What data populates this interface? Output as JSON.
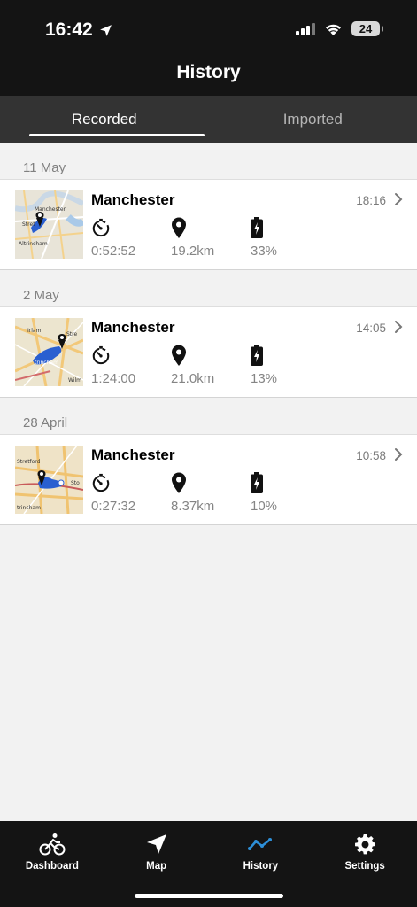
{
  "status_bar": {
    "time": "16:42",
    "battery_level": "24",
    "icons": [
      "location-arrow-icon",
      "signal-icon",
      "wifi-icon",
      "battery-icon"
    ]
  },
  "header": {
    "title": "History"
  },
  "tabs": [
    {
      "label": "Recorded",
      "active": true
    },
    {
      "label": "Imported",
      "active": false
    }
  ],
  "rides": [
    {
      "date": "11 May",
      "city": "Manchester",
      "time": "18:16",
      "duration": "0:52:52",
      "distance": "19.2km",
      "battery": "33%",
      "map_labels": [
        "Manchester",
        "Stret",
        "Altrincham"
      ]
    },
    {
      "date": "2 May",
      "city": "Manchester",
      "time": "14:05",
      "duration": "1:24:00",
      "distance": "21.0km",
      "battery": "13%",
      "map_labels": [
        "Irlam",
        "Stre",
        "trincham",
        "Wilm"
      ]
    },
    {
      "date": "28 April",
      "city": "Manchester",
      "time": "10:58",
      "duration": "0:27:32",
      "distance": "8.37km",
      "battery": "10%",
      "map_labels": [
        "Stretford",
        "Sto",
        "trincham"
      ]
    }
  ],
  "stat_icons": [
    "stopwatch-icon",
    "map-pin-icon",
    "battery-charging-icon"
  ],
  "bottom_nav": [
    {
      "label": "Dashboard",
      "icon": "bicycle-icon",
      "active": false
    },
    {
      "label": "Map",
      "icon": "navigation-arrow-icon",
      "active": false
    },
    {
      "label": "History",
      "icon": "chart-line-icon",
      "active": true
    },
    {
      "label": "Settings",
      "icon": "gear-icon",
      "active": false
    }
  ],
  "colors": {
    "header_bg": "#141414",
    "tab_bg": "#333333",
    "accent": "#2d8fd8",
    "route": "#1f56c8"
  }
}
